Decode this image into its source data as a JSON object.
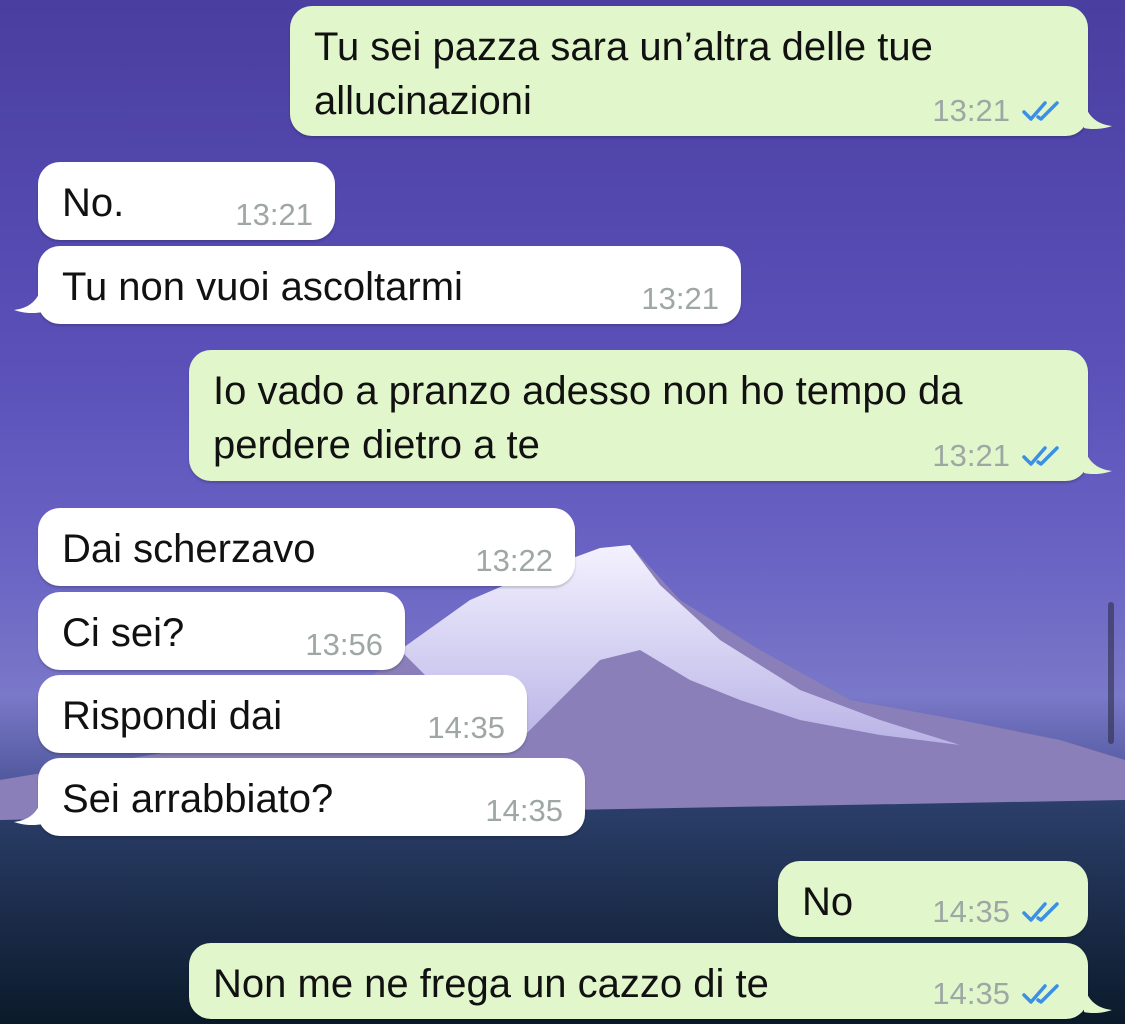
{
  "messages": [
    {
      "text": "Tu sei pazza sara un’altra delle tue allucinazioni",
      "time": "13:21",
      "direction": "out",
      "status": "read",
      "tail": true
    },
    {
      "text": "No.",
      "time": "13:21",
      "direction": "in",
      "tail": false
    },
    {
      "text": "Tu non vuoi ascoltarmi",
      "time": "13:21",
      "direction": "in",
      "tail": true
    },
    {
      "text": "Io vado a pranzo adesso non ho tempo da perdere dietro a te",
      "time": "13:21",
      "direction": "out",
      "status": "read",
      "tail": true
    },
    {
      "text": "Dai scherzavo",
      "time": "13:22",
      "direction": "in",
      "tail": false
    },
    {
      "text": "Ci sei?",
      "time": "13:56",
      "direction": "in",
      "tail": false
    },
    {
      "text": "Rispondi dai",
      "time": "14:35",
      "direction": "in",
      "tail": false
    },
    {
      "text": "Sei arrabbiato?",
      "time": "14:35",
      "direction": "in",
      "tail": true
    },
    {
      "text": "No",
      "time": "14:35",
      "direction": "out",
      "status": "read",
      "tail": false
    },
    {
      "text": "Non me ne frega un cazzo di te",
      "time": "14:35",
      "direction": "out",
      "status": "read",
      "tail": true
    }
  ],
  "icons": {
    "read_receipt": "double-check-icon"
  },
  "colors": {
    "incoming_bubble": "#ffffff",
    "outgoing_bubble": "#e1f7cb",
    "read_tick": "#3b8fe6",
    "timestamp": "#9ea7a4"
  }
}
